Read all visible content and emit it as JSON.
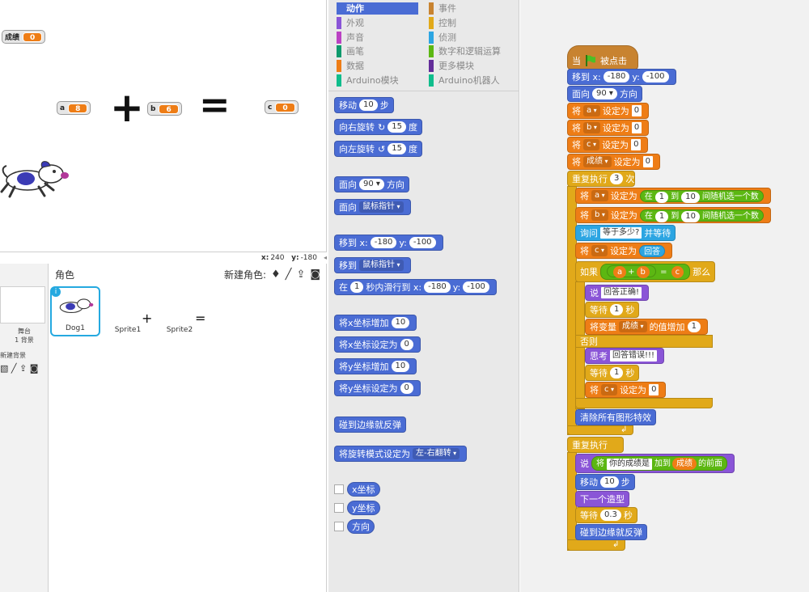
{
  "stage": {
    "monitor_score": {
      "label": "成绩",
      "value": "0"
    },
    "monitor_a": {
      "label": "a",
      "value": "8"
    },
    "monitor_b": {
      "label": "b",
      "value": "6"
    },
    "monitor_c": {
      "label": "c",
      "value": "0"
    },
    "plus": "+",
    "equals": "=",
    "coords": {
      "x_label": "x:",
      "x": "240",
      "y_label": "y:",
      "y": "-180"
    }
  },
  "sprites": {
    "header": "角色",
    "new_label": "新建角色:",
    "stage_name": "舞台",
    "stage_bg_count": "1 背景",
    "new_backdrop": "新建背景",
    "items": [
      {
        "name": "Dog1",
        "thumb_text": ""
      },
      {
        "name": "Sprite1",
        "thumb_text": "+"
      },
      {
        "name": "Sprite2",
        "thumb_text": "="
      }
    ]
  },
  "palette": {
    "categories": [
      {
        "label": "动作",
        "color": "#4a6cd4"
      },
      {
        "label": "事件",
        "color": "#c88330"
      },
      {
        "label": "外观",
        "color": "#8a55d7"
      },
      {
        "label": "控制",
        "color": "#e1a91a"
      },
      {
        "label": "声音",
        "color": "#bb42c3"
      },
      {
        "label": "侦测",
        "color": "#2ca5e2"
      },
      {
        "label": "画笔",
        "color": "#0e9a6c"
      },
      {
        "label": "数字和逻辑运算",
        "color": "#5cb712"
      },
      {
        "label": "数据",
        "color": "#ee7d16"
      },
      {
        "label": "更多模块",
        "color": "#632d99"
      },
      {
        "label": "Arduino模块",
        "color": "#0fbd8c"
      },
      {
        "label": "Arduino机器人",
        "color": "#0fbd8c"
      }
    ],
    "b_move": "移动",
    "b_move_n": "10",
    "b_move_u": "步",
    "b_turn_r": "向右旋转",
    "b_turn_r_n": "15",
    "b_turn_r_u": "度",
    "b_turn_l": "向左旋转",
    "b_turn_l_n": "15",
    "b_turn_l_u": "度",
    "b_face": "面向",
    "b_face_n": "90",
    "b_face_u": "方向",
    "b_face2": "面向",
    "b_face2_v": "鼠标指针",
    "b_goto": "移到 x:",
    "b_goto_x": "-180",
    "b_goto_y_l": "y:",
    "b_goto_y": "-100",
    "b_goto2": "移到",
    "b_goto2_v": "鼠标指针",
    "b_glide": "在",
    "b_glide_n": "1",
    "b_glide_m": "秒内滑行到 x:",
    "b_glide_x": "-180",
    "b_glide_y_l": "y:",
    "b_glide_y": "-100",
    "b_chx": "将x坐标增加",
    "b_chx_n": "10",
    "b_setx": "将x坐标设定为",
    "b_setx_n": "0",
    "b_chy": "将y坐标增加",
    "b_chy_n": "10",
    "b_sety": "将y坐标设定为",
    "b_sety_n": "0",
    "b_bounce": "碰到边缘就反弹",
    "b_rot": "将旋转模式设定为",
    "b_rot_v": "左-右翻转",
    "r_x": "x坐标",
    "r_y": "y坐标",
    "r_dir": "方向"
  },
  "script": {
    "hat_when": "当",
    "hat_clicked": "被点击",
    "goto": "移到 x:",
    "goto_x": "-180",
    "goto_y_l": "y:",
    "goto_y": "-100",
    "face": "面向",
    "face_n": "90",
    "face_u": "方向",
    "set_word": "将",
    "set_to": "设定为",
    "v_a": "a",
    "v_b": "b",
    "v_c": "c",
    "v_score": "成绩",
    "zero": "0",
    "repeat": "重复执行",
    "repeat_n": "3",
    "repeat_u": "次",
    "in": "在",
    "one": "1",
    "to": "到",
    "ten": "10",
    "pick": "间随机选一个数",
    "ask": "询问",
    "ask_q": "等于多少?",
    "ask_wait": "并等待",
    "answer": "回答",
    "if": "如果",
    "plus": "+",
    "eq": "=",
    "then": "那么",
    "say": "说",
    "correct": "回答正确!",
    "wait": "等待",
    "wait_n": "1",
    "wait_u": "秒",
    "change_var": "将变量",
    "change_by": "的值增加",
    "change_n": "1",
    "else": "否则",
    "think": "思考",
    "wrong": "回答错误!!!",
    "clear": "清除所有图形特效",
    "forever": "重复执行",
    "join_a": "你的成绩是",
    "join_w": "加到",
    "join_e": "的前面",
    "move": "移动",
    "move_n": "10",
    "move_u": "步",
    "next_costume": "下一个造型",
    "wait2_n": "0.3",
    "wait2_u": "秒",
    "bounce": "碰到边缘就反弹"
  }
}
